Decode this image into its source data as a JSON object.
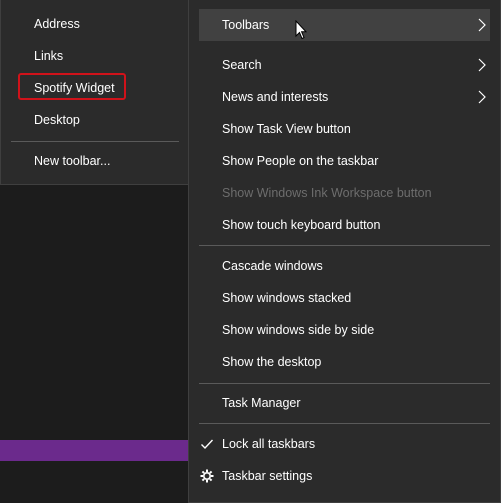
{
  "toolbars_submenu": {
    "items": [
      {
        "label": "Address"
      },
      {
        "label": "Links"
      },
      {
        "label": "Spotify Widget"
      },
      {
        "label": "Desktop"
      }
    ],
    "new_toolbar": "New toolbar..."
  },
  "taskbar_menu": {
    "toolbars": "Toolbars",
    "search": "Search",
    "news": "News and interests",
    "task_view": "Show Task View button",
    "people": "Show People on the taskbar",
    "ink": "Show Windows Ink Workspace button",
    "touch_keyboard": "Show touch keyboard button",
    "cascade": "Cascade windows",
    "stacked": "Show windows stacked",
    "side_by_side": "Show windows side by side",
    "show_desktop": "Show the desktop",
    "task_manager": "Task Manager",
    "lock": "Lock all taskbars",
    "settings": "Taskbar settings"
  },
  "colors": {
    "menu_bg": "#2b2b2b",
    "highlight": "#414141",
    "focus_ring": "#d0121a",
    "disabled_text": "#6d6d6d",
    "taskbar_accent": "#6b2a8c"
  }
}
